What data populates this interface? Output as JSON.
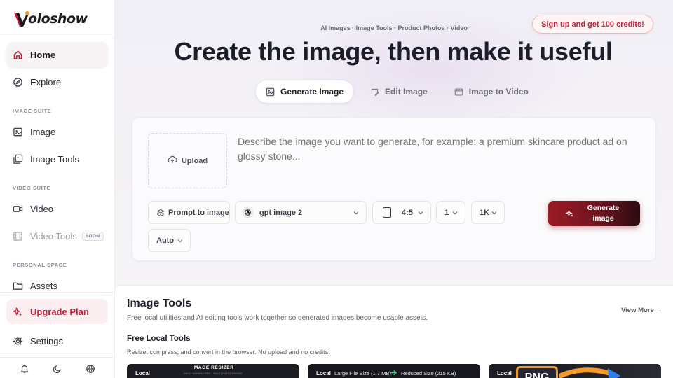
{
  "brand": {
    "logo_text": "oloshow",
    "accent": "#c4203b"
  },
  "sidebar": {
    "items": [
      {
        "label": "Home",
        "icon": "home-icon",
        "active": true
      },
      {
        "label": "Explore",
        "icon": "compass-icon"
      },
      {
        "label": "Image",
        "icon": "image-icon"
      },
      {
        "label": "Image Tools",
        "icon": "image-tools-icon"
      },
      {
        "label": "Video",
        "icon": "video-icon"
      },
      {
        "label": "Video Tools",
        "icon": "film-icon",
        "badge": "SOON",
        "disabled": true
      },
      {
        "label": "Assets",
        "icon": "folder-icon"
      }
    ],
    "sections": {
      "image": "IMAGE SUITE",
      "video": "VIDEO SUITE",
      "personal": "PERSONAL SPACE"
    },
    "upgrade": {
      "label": "Upgrade Plan",
      "icon": "sparkle-icon"
    },
    "settings": {
      "label": "Settings",
      "icon": "gear-icon"
    },
    "bottom_icons": [
      "bell-icon",
      "moon-icon",
      "globe-icon"
    ]
  },
  "header": {
    "signup_label": "Sign up and get 100 credits!",
    "kicker": "AI Images · Image Tools · Product Photos · Video",
    "headline": "Create the image, then make it useful"
  },
  "tabs": [
    {
      "label": "Generate Image",
      "icon": "image-icon",
      "active": true
    },
    {
      "label": "Edit Image",
      "icon": "edit-image-icon"
    },
    {
      "label": "Image to Video",
      "icon": "film-icon"
    }
  ],
  "composer": {
    "upload_label": "Upload",
    "prompt_placeholder": "Describe the image you want to generate, for example: a premium skincare product ad on glossy stone...",
    "prompt_mode": "Prompt to image",
    "model": "gpt image 2",
    "aspect_ratio": "4:5",
    "count": "1",
    "resolution": "1K",
    "quality": "Auto",
    "generate_label": "Generate image"
  },
  "tools": {
    "title": "Image Tools",
    "subtitle": "Free local utilities and AI editing tools work together so generated images become usable assets.",
    "view_more": "View More →",
    "local_title": "Free Local Tools",
    "local_subtitle": "Resize, compress, and convert in the browser. No upload and no credits.",
    "cards": [
      {
        "tag": "Local",
        "heading": "IMAGE RESIZER",
        "caption": "NANO BANANA PRO · MULTI RATIO ENGINE"
      },
      {
        "tag": "Local",
        "before": "Large File Size (1.7 MB)",
        "after": "Reduced Size (215 KB)"
      },
      {
        "tag": "Local",
        "format": "PNG"
      }
    ]
  }
}
